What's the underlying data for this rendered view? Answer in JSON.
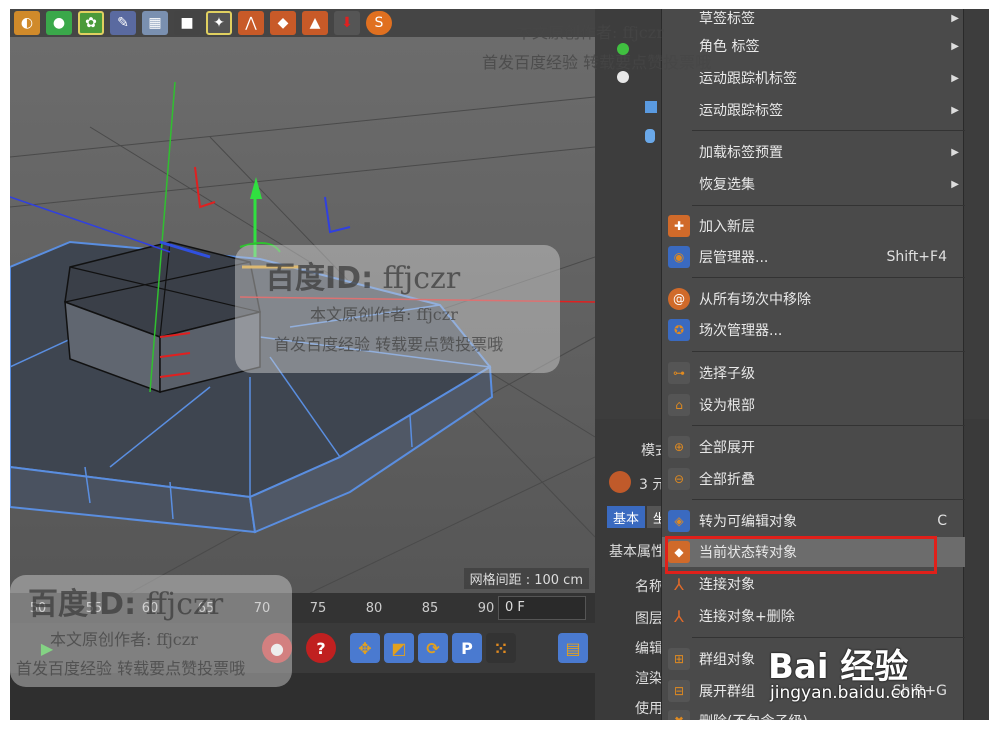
{
  "viewport": {
    "grid_spacing": "网格间距 : 100 cm"
  },
  "timeline": {
    "ticks": [
      "50",
      "55",
      "60",
      "65",
      "70",
      "75",
      "80",
      "85",
      "90"
    ],
    "frame_value": "0 F"
  },
  "attributes": {
    "tab_mode": "模式",
    "count": "3 元",
    "tab_basic": "基本",
    "tab_coord": "坐",
    "basic_props": "基本属性",
    "name_label": "名称",
    "layer_label": "图层",
    "editor_label": "编辑",
    "render_label": "渲染",
    "use_label": "使用"
  },
  "context_menu": {
    "items": [
      {
        "label": "草签标签",
        "shortcut": "",
        "submenu": true
      },
      {
        "label": "角色 标签",
        "shortcut": "",
        "submenu": true
      },
      {
        "label": "运动跟踪机标签",
        "shortcut": "",
        "submenu": true
      },
      {
        "label": "运动跟踪标签",
        "shortcut": "",
        "submenu": true
      },
      {
        "label": "加载标签预置",
        "shortcut": "",
        "submenu": true
      },
      {
        "label": "恢复选集",
        "shortcut": "",
        "submenu": true
      },
      {
        "label": "加入新层",
        "shortcut": ""
      },
      {
        "label": "层管理器...",
        "shortcut": "Shift+F4"
      },
      {
        "label": "从所有场次中移除",
        "shortcut": ""
      },
      {
        "label": "场次管理器...",
        "shortcut": ""
      },
      {
        "label": "选择子级",
        "shortcut": ""
      },
      {
        "label": "设为根部",
        "shortcut": ""
      },
      {
        "label": "全部展开",
        "shortcut": ""
      },
      {
        "label": "全部折叠",
        "shortcut": ""
      },
      {
        "label": "转为可编辑对象",
        "shortcut": "C"
      },
      {
        "label": "当前状态转对象",
        "shortcut": ""
      },
      {
        "label": "连接对象",
        "shortcut": ""
      },
      {
        "label": "连接对象+删除",
        "shortcut": ""
      },
      {
        "label": "群组对象",
        "shortcut": ""
      },
      {
        "label": "展开群组",
        "shortcut": "Shift+G"
      },
      {
        "label": "删除(不包含子级)",
        "shortcut": ""
      }
    ]
  },
  "watermark": {
    "id_prefix": "百度ID:",
    "id_value": "ffjczr",
    "line1": "本文原创作者: ffjczr",
    "line2": "首发百度经验 转载要点赞投票哦"
  },
  "baidu": {
    "logo": "Bai 经验",
    "url": "jingyan.baidu.com"
  }
}
